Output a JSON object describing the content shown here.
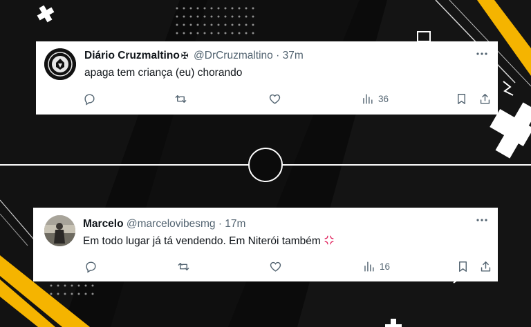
{
  "colors": {
    "accent": "#f5b400",
    "background": "#0b0b0b",
    "card": "#ffffff",
    "text_primary": "#0f1419",
    "text_secondary": "#536471",
    "anger_emoji": "#e0245e"
  },
  "tweets": [
    {
      "name": "Diário Cruzmaltino",
      "badge": "✠",
      "handle": "@DrCruzmaltino",
      "separator": "·",
      "time": "37m",
      "text": "apaga tem criança (eu) chorando",
      "views": "36",
      "avatar_icon": "club-logo-avatar"
    },
    {
      "name": "Marcelo",
      "handle": "@marcelovibesmg",
      "separator": "·",
      "time": "17m",
      "text": "Em todo lugar já tá vendendo. Em Niterói também",
      "emoji": "anger-symbol-icon",
      "views": "16",
      "avatar_icon": "user-photo-avatar"
    }
  ]
}
